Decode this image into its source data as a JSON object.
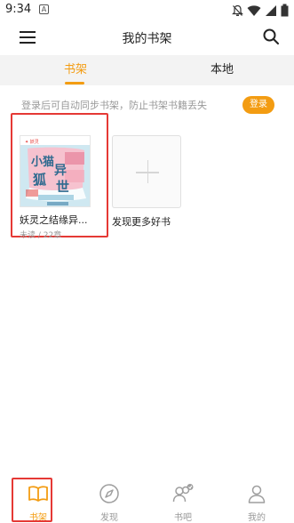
{
  "status_bar": {
    "time": "9:34",
    "notification_letter": "A",
    "icons": [
      "notifications-off-icon",
      "wifi-icon",
      "signal-icon",
      "battery-icon"
    ]
  },
  "app_bar": {
    "title": "我的书架",
    "menu_icon": "menu-icon",
    "search_icon": "search-icon"
  },
  "tabs": [
    {
      "label": "书架",
      "active": true
    },
    {
      "label": "本地",
      "active": false
    }
  ],
  "sync_tip": {
    "text": "登录后可自动同步书架，防止书架书籍丢失",
    "login_label": "登录"
  },
  "books": [
    {
      "title": "妖灵之结缘异...",
      "progress": "未读 / 22章",
      "cover_lines": [
        "小猫",
        "狐",
        "异",
        "世"
      ]
    }
  ],
  "add_book": {
    "label": "发现更多好书"
  },
  "bottom_nav": [
    {
      "label": "书架",
      "icon": "book-open-icon",
      "active": true
    },
    {
      "label": "发现",
      "icon": "compass-icon",
      "active": false
    },
    {
      "label": "书吧",
      "icon": "group-chat-icon",
      "active": false
    },
    {
      "label": "我的",
      "icon": "person-icon",
      "active": false
    }
  ],
  "colors": {
    "accent": "#f39c12",
    "highlight_border": "#e53935",
    "tab_bar_bg": "#f3f3f3",
    "muted_text": "#999999"
  }
}
